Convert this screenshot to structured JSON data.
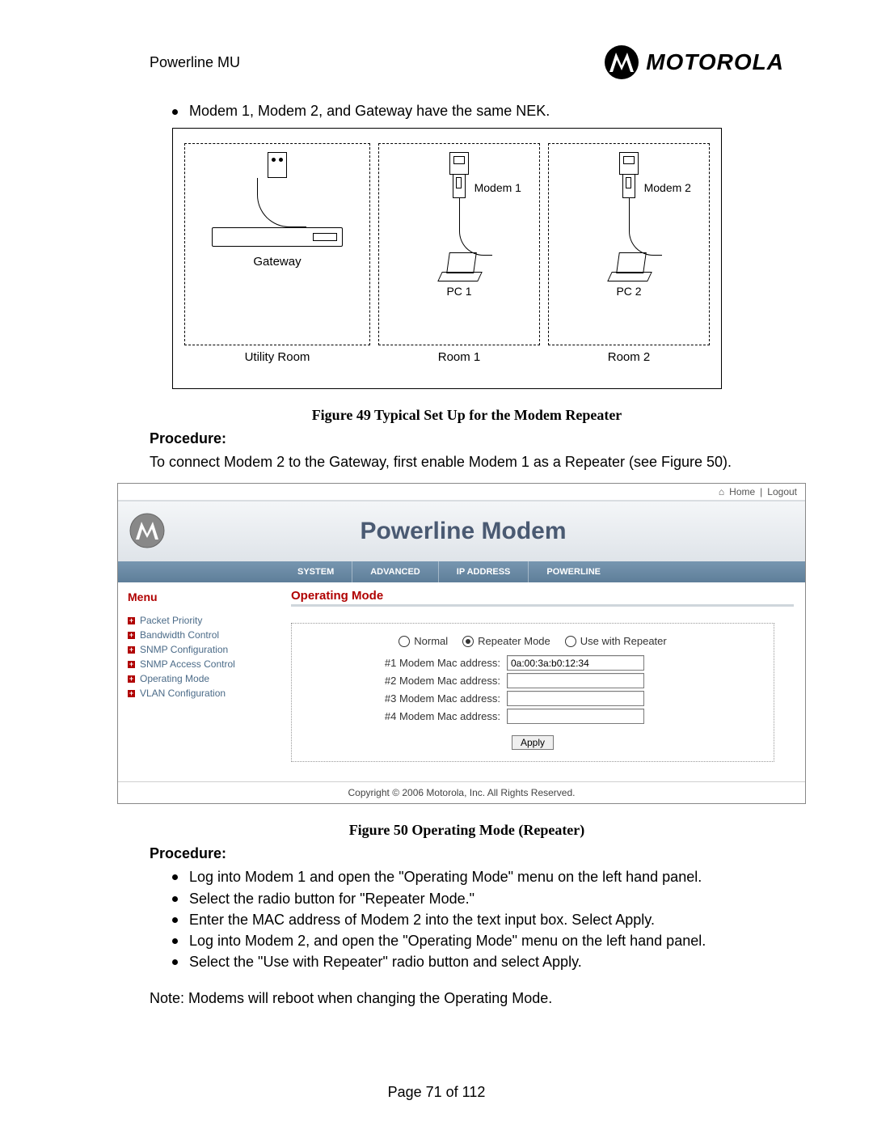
{
  "header": {
    "title": "Powerline MU",
    "brand": "MOTOROLA"
  },
  "intro_bullet": "Modem 1, Modem 2, and Gateway have the same NEK.",
  "diagram": {
    "gateway": "Gateway",
    "modem1": "Modem 1",
    "modem2": "Modem 2",
    "pc1": "PC 1",
    "pc2": "PC 2",
    "utility": "Utility Room",
    "room1": "Room 1",
    "room2": "Room 2"
  },
  "fig49": "Figure 49 Typical Set Up for the Modem Repeater",
  "procedure_label": "Procedure:",
  "proc_intro": "To connect Modem 2 to the Gateway, first enable Modem 1 as a Repeater (see Figure 50).",
  "shot": {
    "home": "Home",
    "logout": "Logout",
    "divider": " | ",
    "banner": "Powerline Modem",
    "nav": [
      "SYSTEM",
      "ADVANCED",
      "IP ADDRESS",
      "POWERLINE"
    ],
    "menu_header": "Menu",
    "menu_items": [
      "Packet Priority",
      "Bandwidth Control",
      "SNMP Configuration",
      "SNMP Access Control",
      "Operating Mode",
      "VLAN Configuration"
    ],
    "content_title": "Operating Mode",
    "radios": {
      "normal": "Normal",
      "repeater": "Repeater Mode",
      "usewith": "Use with Repeater"
    },
    "mac": {
      "l1": "#1 Modem Mac address:",
      "l2": "#2 Modem Mac address:",
      "l3": "#3 Modem Mac address:",
      "l4": "#4 Modem Mac address:",
      "v1": "0a:00:3a:b0:12:34"
    },
    "apply": "Apply",
    "footer": "Copyright  ©   2006  Motorola, Inc.  All Rights Reserved."
  },
  "fig50": "Figure 50 Operating Mode (Repeater)",
  "steps": [
    "Log into Modem 1 and open the \"Operating Mode\" menu on the left hand panel.",
    "Select the radio button for \"Repeater Mode.\"",
    "Enter the MAC address of Modem 2 into the text input box. Select Apply.",
    "Log into Modem 2, and open the \"Operating Mode\" menu on the left hand panel.",
    "Select the \"Use with Repeater\" radio button and select Apply."
  ],
  "note": "Note: Modems will reboot when changing the Operating Mode.",
  "page": "Page 71 of 112",
  "apply_bold": "Apply"
}
